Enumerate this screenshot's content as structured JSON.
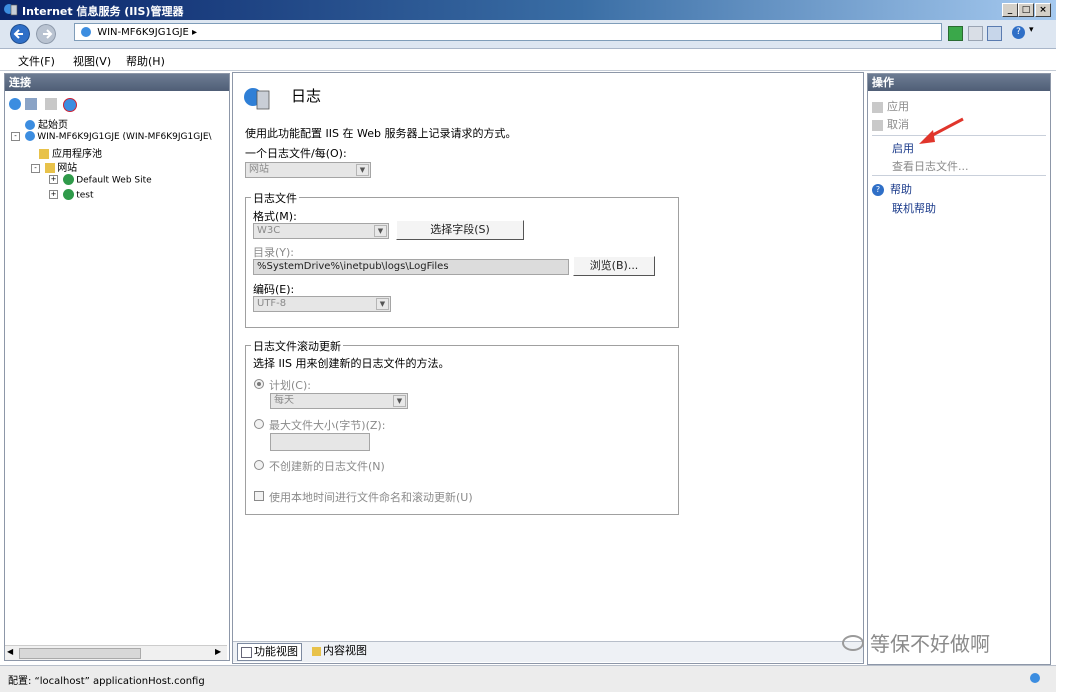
{
  "window": {
    "title": "Internet 信息服务 (IIS)管理器"
  },
  "address": {
    "path": "WIN-MF6K9JG1GJE ▸"
  },
  "menu": {
    "items": [
      "文件(F)",
      "视图(V)",
      "帮助(H)"
    ]
  },
  "left_panel": {
    "header": "连接",
    "tree": {
      "start_page": "起始页",
      "server": "WIN-MF6K9JG1GJE (WIN-MF6K9JG1GJE\\",
      "app_pools": "应用程序池",
      "sites": "网站",
      "site1": "Default Web Site",
      "site2": "test"
    }
  },
  "center": {
    "title": "日志",
    "description": "使用此功能配置 IIS 在 Web 服务器上记录请求的方式。",
    "one_file_per_label": "一个日志文件/每(O):",
    "one_file_per_value": "网站",
    "log_file_group": "日志文件",
    "format_label": "格式(M):",
    "format_value": "W3C",
    "select_fields_button": "选择字段(S)",
    "directory_label": "目录(Y):",
    "directory_value": "%SystemDrive%\\inetpub\\logs\\LogFiles",
    "browse_button": "浏览(B)...",
    "encoding_label": "编码(E):",
    "encoding_value": "UTF-8",
    "rollover_group": "日志文件滚动更新",
    "rollover_desc": "选择 IIS 用来创建新的日志文件的方法。",
    "schedule_label": "计划(C):",
    "schedule_value": "每天",
    "max_size_label": "最大文件大小(字节)(Z):",
    "no_new_label": "不创建新的日志文件(N)",
    "local_time_label": "使用本地时间进行文件命名和滚动更新(U)",
    "tab_feature": "功能视图",
    "tab_content": "内容视图"
  },
  "right_panel": {
    "header": "操作",
    "apply": "应用",
    "cancel": "取消",
    "enable": "启用",
    "view_logs": "查看日志文件...",
    "help": "帮助",
    "online_help": "联机帮助"
  },
  "status": {
    "text": "配置: “localhost” applicationHost.config"
  },
  "watermark": {
    "text": "等保不好做啊"
  },
  "colors": {
    "accent_red": "#e0352b",
    "link_blue": "#1a3a8a",
    "title_dark": "#0a246a"
  }
}
